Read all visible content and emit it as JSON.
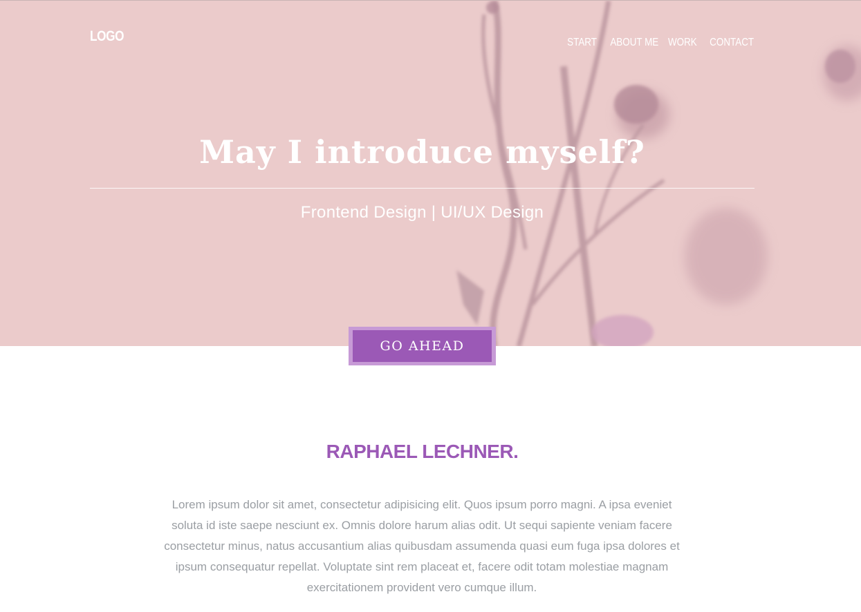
{
  "header": {
    "logo": "LOGO",
    "nav": [
      {
        "label": "START"
      },
      {
        "label": "ABOUT ME"
      },
      {
        "label": "WORK"
      },
      {
        "label": "CONTACT"
      }
    ]
  },
  "hero": {
    "title": "May I introduce myself?",
    "subtitle": "Frontend Design | UI/UX Design",
    "button_label": "GO AHEAD"
  },
  "about": {
    "name": "RAPHAEL LECHNER.",
    "bio": "Lorem ipsum dolor sit amet, consectetur adipisicing elit. Quos ipsum porro magni. A ipsa eveniet soluta id iste saepe nesciunt ex. Omnis dolore harum alias odit. Ut sequi sapiente veniam facere consectetur minus, natus accusantium alias quibusdam assumenda quasi eum fuga ipsa dolores et ipsum consequatur repellat. Voluptate sint rem placeat et, facere odit totam molestiae magnam exercitationem provident vero cumque illum."
  },
  "colors": {
    "accent": "#9b59b6",
    "accent_border": "#c79ad6",
    "hero_background": "#e9c9c9",
    "body_text": "#9a9ea3"
  }
}
